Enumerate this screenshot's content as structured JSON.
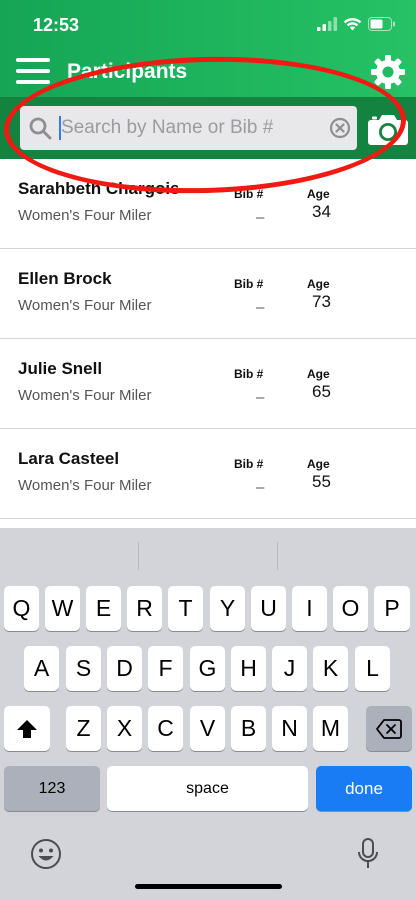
{
  "status_bar": {
    "time": "12:53"
  },
  "header": {
    "title": "Participants"
  },
  "search": {
    "placeholder": "Search by Name or Bib #",
    "value": ""
  },
  "participants": [
    {
      "name": "Sarahbeth Chargois",
      "race": "Women's Four Miler",
      "bib_label": "Bib #",
      "bib": "–",
      "age_label": "Age",
      "age": "34"
    },
    {
      "name": "Ellen Brock",
      "race": "Women's Four Miler",
      "bib_label": "Bib #",
      "bib": "–",
      "age_label": "Age",
      "age": "73"
    },
    {
      "name": "Julie Snell",
      "race": "Women's Four Miler",
      "bib_label": "Bib #",
      "bib": "–",
      "age_label": "Age",
      "age": "65"
    },
    {
      "name": "Lara Casteel",
      "race": "Women's Four Miler",
      "bib_label": "Bib #",
      "bib": "–",
      "age_label": "Age",
      "age": "55"
    }
  ],
  "keyboard": {
    "row1": [
      "Q",
      "W",
      "E",
      "R",
      "T",
      "Y",
      "U",
      "I",
      "O",
      "P"
    ],
    "row2": [
      "A",
      "S",
      "D",
      "F",
      "G",
      "H",
      "J",
      "K",
      "L"
    ],
    "row3": [
      "Z",
      "X",
      "C",
      "V",
      "B",
      "N",
      "M"
    ],
    "numbers_label": "123",
    "space_label": "space",
    "done_label": "done"
  },
  "icons": {
    "menu": "hamburger-menu-icon",
    "settings": "gear-icon",
    "search": "search-icon",
    "clear": "clear-icon",
    "camera": "camera-icon",
    "shift": "shift-icon",
    "backspace": "backspace-icon",
    "emoji": "emoji-icon",
    "mic": "microphone-icon"
  },
  "colors": {
    "header_green": "#1fb55c",
    "search_band_green": "#14833f",
    "highlight_oval": "#f01a12",
    "done_key": "#1a7cf5"
  }
}
